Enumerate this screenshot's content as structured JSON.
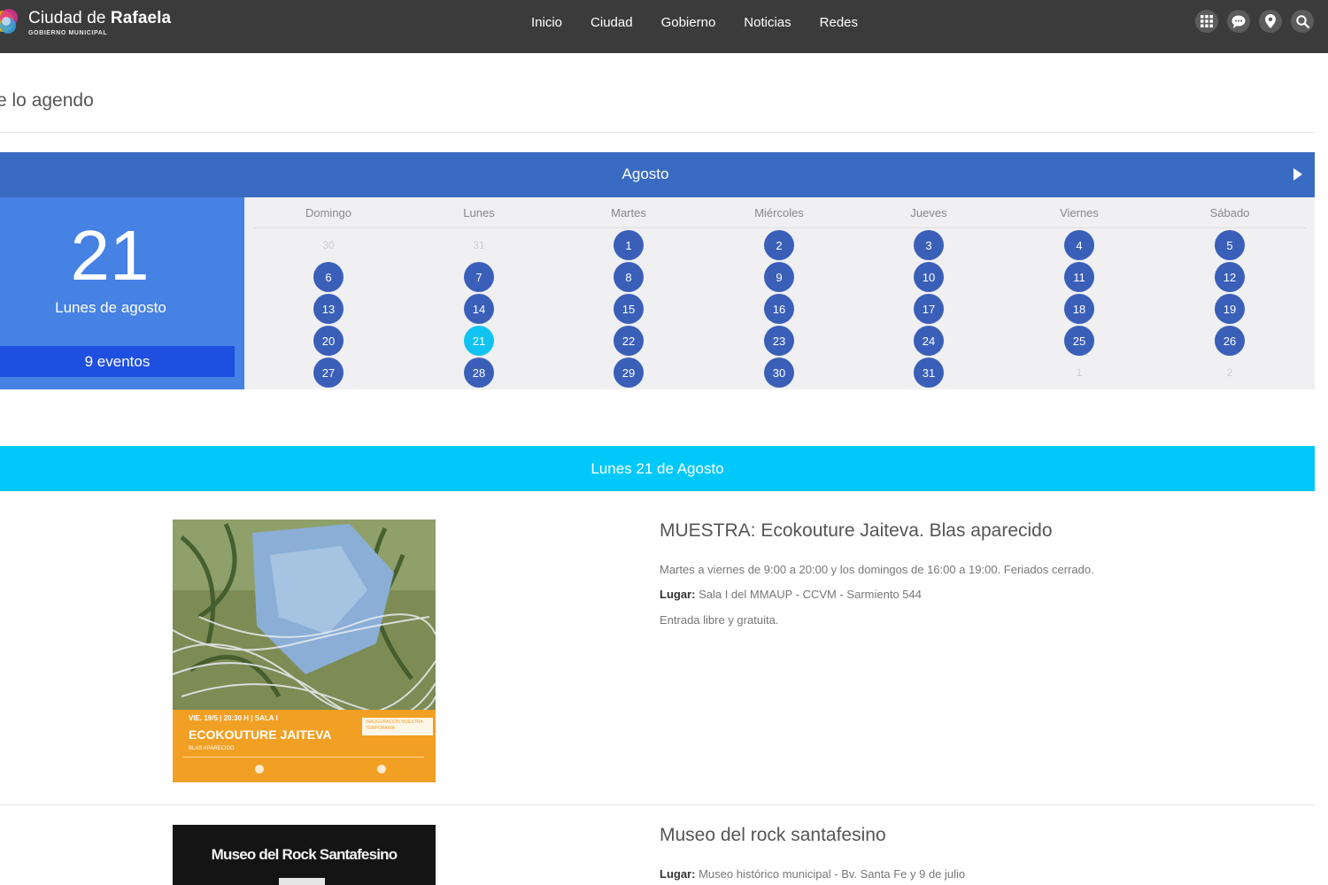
{
  "header": {
    "brand_name_prefix": "Ciudad de",
    "brand_name_bold": "Rafaela",
    "brand_subtitle": "GOBIERNO MUNICIPAL",
    "nav": [
      "Inicio",
      "Ciudad",
      "Gobierno",
      "Noticias",
      "Redes"
    ],
    "icons": [
      "apps-grid-icon",
      "chat-icon",
      "location-pin-icon",
      "search-icon"
    ]
  },
  "page": {
    "title": "e lo agendo"
  },
  "calendar": {
    "month": "Agosto",
    "next_icon": "chevron-right-icon",
    "selected_day": "21",
    "selected_label": "Lunes de agosto",
    "events_count_label": "9 eventos",
    "weekdays": [
      "Domingo",
      "Lunes",
      "Martes",
      "Miércoles",
      "Jueves",
      "Viernes",
      "Sábado"
    ],
    "weeks": [
      [
        "30",
        "31",
        "1",
        "2",
        "3",
        "4",
        "5"
      ],
      [
        "6",
        "7",
        "8",
        "9",
        "10",
        "11",
        "12"
      ],
      [
        "13",
        "14",
        "15",
        "16",
        "17",
        "18",
        "19"
      ],
      [
        "20",
        "21",
        "22",
        "23",
        "24",
        "25",
        "26"
      ],
      [
        "27",
        "28",
        "29",
        "30",
        "31",
        "1",
        "2"
      ]
    ],
    "selected_color": "#10c3f0",
    "day_color": "#3a5fb9"
  },
  "day_banner": "Lunes 21 de Agosto",
  "events": [
    {
      "title": "MUESTRA: Ecokouture Jaiteva. Blas aparecido",
      "schedule": "Martes a viernes de 9:00 a 20:00 y los domingos de 16:00 a 19:00. Feriados cerrado.",
      "place_label": "Lugar:",
      "place": "Sala I del MMAUP - CCVM - Sarmiento 544",
      "note": "Entrada libre y gratuita.",
      "poster": {
        "date_line": "VIE. 19/5 | 20:30 H | SALA I",
        "name": "ECOKOUTURE JAITEVA",
        "artist": "BLAS APARECIDO",
        "badge": "INAUGURACIÓN MUESTRA TEMPORARIA"
      }
    },
    {
      "title": "Museo del rock santafesino",
      "place_label": "Lugar:",
      "place": "Museo histórico municipal - Bv. Santa Fe y 9 de julio",
      "poster": {
        "name": "Museo del Rock Santafesino"
      }
    }
  ],
  "colors": {
    "topbar": "#3b3b3b",
    "calendar_header": "#3a6bc2",
    "day_panel": "#4682e4",
    "events_button": "#1f4fe0",
    "banner": "#00c8f8"
  }
}
